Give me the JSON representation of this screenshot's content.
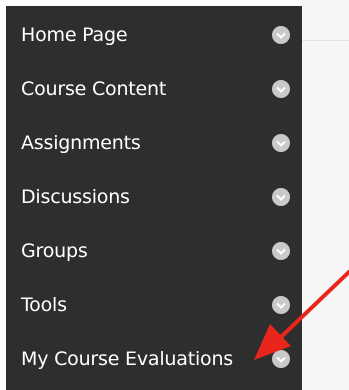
{
  "nav": {
    "items": [
      {
        "label": "Home Page",
        "icon": "chevron-down-icon"
      },
      {
        "label": "Course Content",
        "icon": "chevron-down-icon"
      },
      {
        "label": "Assignments",
        "icon": "chevron-down-icon"
      },
      {
        "label": "Discussions",
        "icon": "chevron-down-icon"
      },
      {
        "label": "Groups",
        "icon": "chevron-down-icon"
      },
      {
        "label": "Tools",
        "icon": "chevron-down-icon"
      },
      {
        "label": "My Course Evaluations",
        "icon": "chevron-down-icon"
      }
    ]
  },
  "colors": {
    "sidebar_background": "#2e2e2e",
    "sidebar_text": "#ffffff",
    "chevron_fill": "#c9c9c9",
    "annotation_arrow": "#e8261c"
  }
}
